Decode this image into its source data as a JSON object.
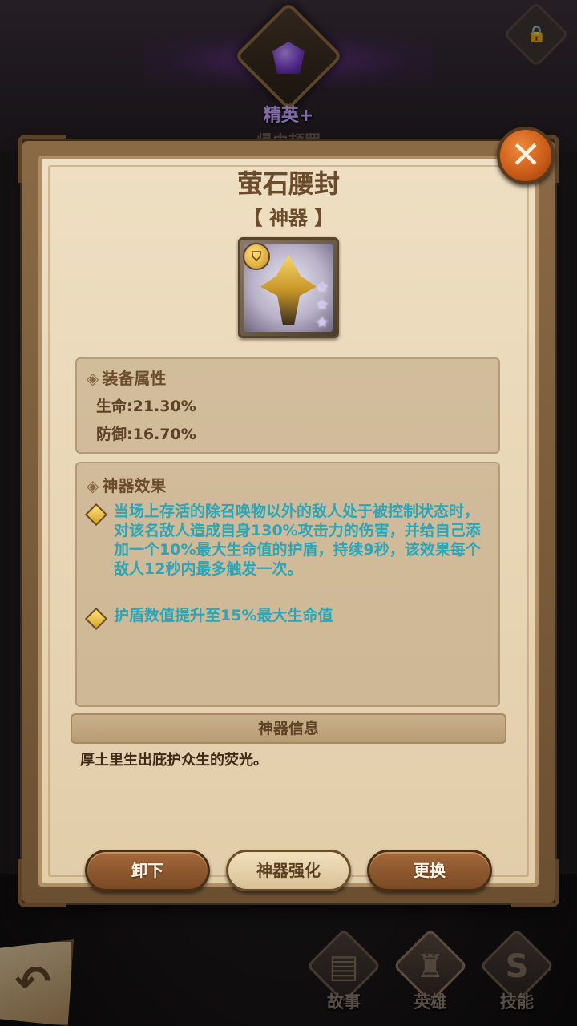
{
  "background": {
    "rank_label": "精英+",
    "rank_sub": "帰由颉罢",
    "lock_icon": "lock-icon"
  },
  "dialog": {
    "title": "萤石腰封",
    "type": "【 神器 】",
    "close_icon": "close-icon",
    "attributes": {
      "heading": "装备属性",
      "lines": [
        "生命:21.30%",
        "防御:16.70%"
      ]
    },
    "effects": {
      "heading": "神器效果",
      "items": [
        "当场上存活的除召唤物以外的敌人处于被控制状态时，对该名敌人造成自身130%攻击力的伤害，并给自己添加一个10%最大生命值的护盾，持续9秒，该效果每个敌人12秒内最多触发一次。",
        "护盾数值提升至15%最大生命值"
      ],
      "text_color": "#2aa6b8"
    },
    "info": {
      "heading": "神器信息",
      "text": "厚土里生出庇护众生的荧光。"
    },
    "buttons": {
      "unequip": "卸下",
      "enhance": "神器强化",
      "replace": "更换"
    }
  },
  "bottom_nav": {
    "back_icon": "back-arrow-icon",
    "items": [
      {
        "label": "故事",
        "icon": "book-icon"
      },
      {
        "label": "英雄",
        "icon": "helmet-icon"
      },
      {
        "label": "技能",
        "icon": "skill-s-icon"
      }
    ]
  },
  "colors": {
    "accent_orange": "#c85a18",
    "paper": "#e8d6b6",
    "frame": "#6b4f31",
    "effect_cyan": "#2aa6b8"
  }
}
